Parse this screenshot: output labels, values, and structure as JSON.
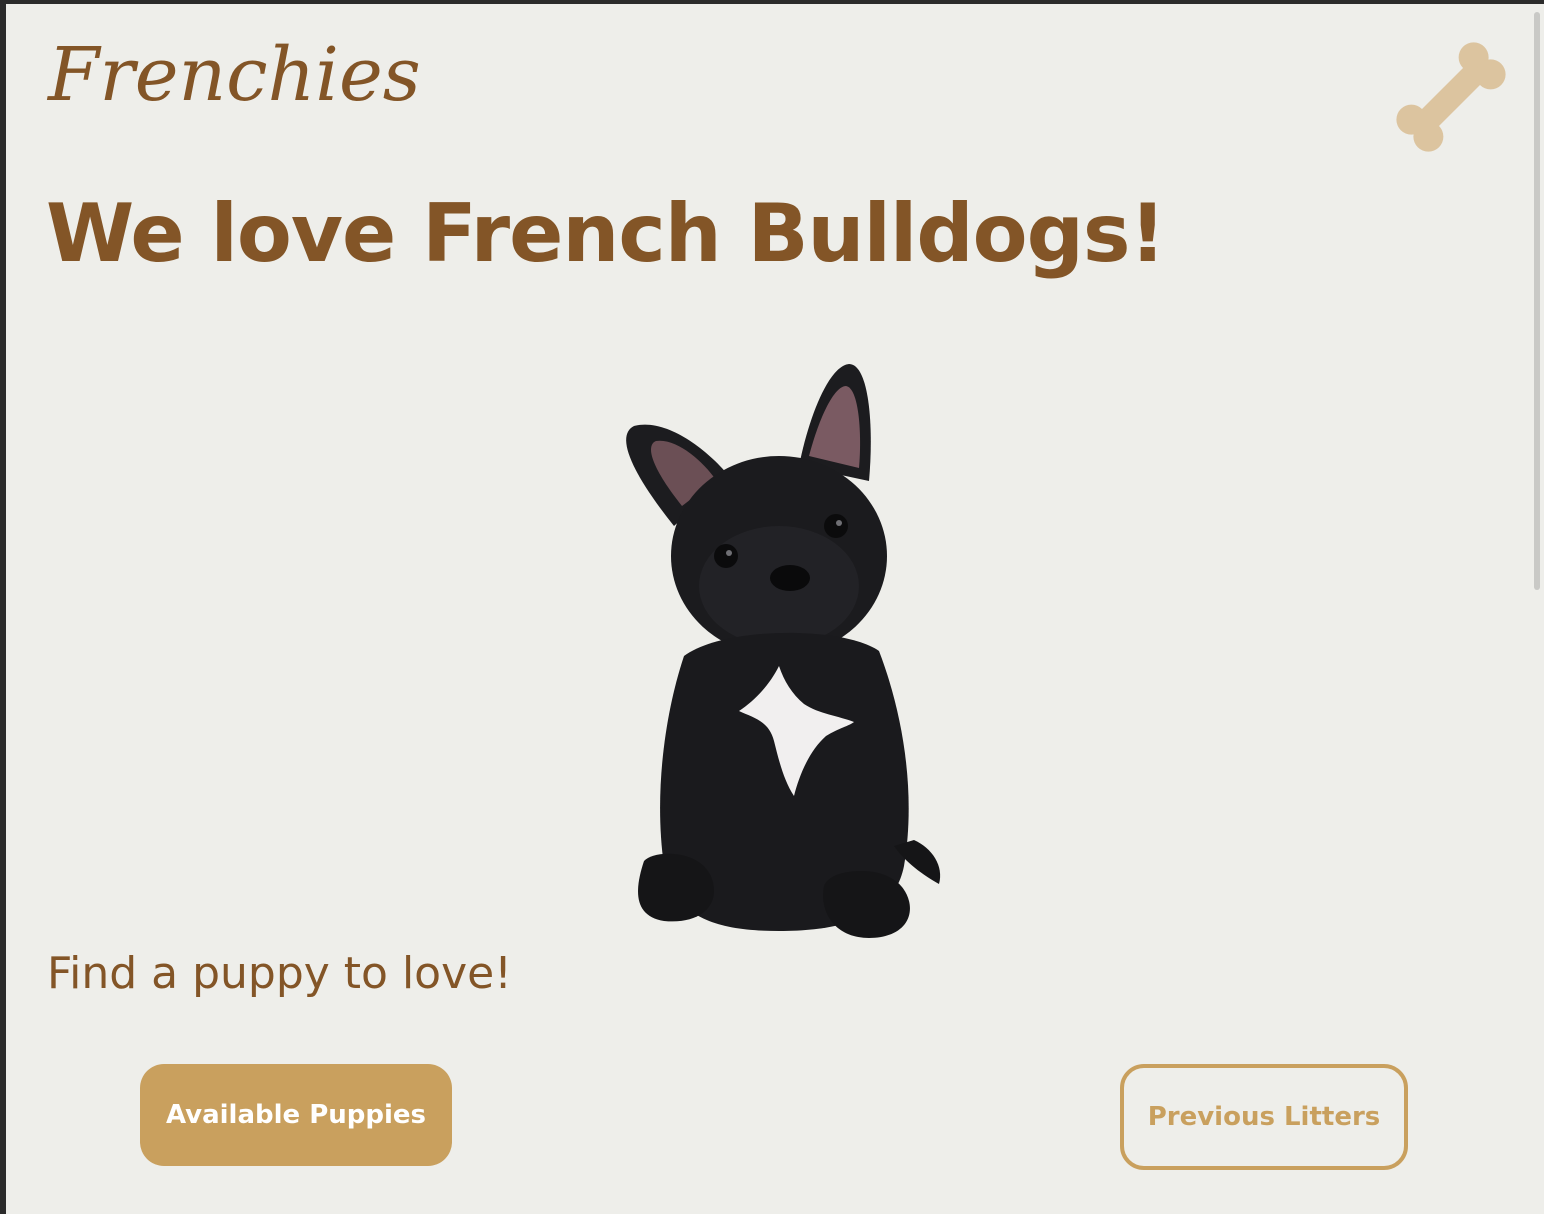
{
  "brand": {
    "logo_text": "Frenchies",
    "menu_icon": "bone-icon",
    "colors": {
      "primary": "#835527",
      "accent": "#c9a05e",
      "background": "#eeeeea",
      "button_text": "#ffffff"
    }
  },
  "hero": {
    "headline": "We love French Bulldogs!",
    "image_subject": "french-bulldog-puppy",
    "tagline": "Find a puppy to love!"
  },
  "actions": {
    "primary_label": "Available Puppies",
    "secondary_label": "Previous Litters"
  }
}
